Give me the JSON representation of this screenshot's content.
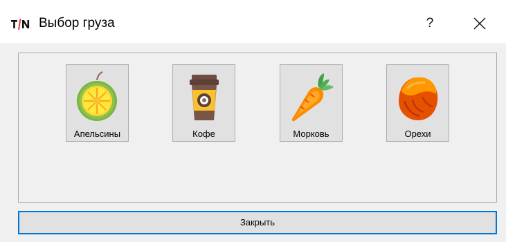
{
  "window": {
    "title": "Выбор груза",
    "help_label": "?"
  },
  "cargo": {
    "items": [
      {
        "label": "Апельсины",
        "icon": "orange-icon"
      },
      {
        "label": "Кофе",
        "icon": "coffee-cup-icon"
      },
      {
        "label": "Морковь",
        "icon": "carrot-icon"
      },
      {
        "label": "Орехи",
        "icon": "hazelnut-icon"
      }
    ]
  },
  "footer": {
    "close_label": "Закрыть"
  },
  "colors": {
    "focus_border": "#0078d7",
    "button_face": "#e1e1e1",
    "panel_bg": "#f0f0f0",
    "logo_red": "#e53935"
  }
}
